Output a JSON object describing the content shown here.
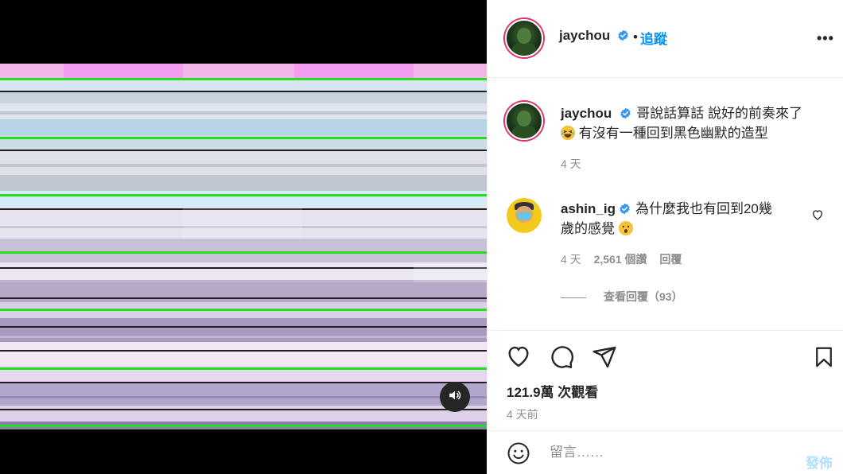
{
  "header": {
    "username": "jaychou",
    "follow_label": "追蹤",
    "separator": "•",
    "more_label": "•••"
  },
  "caption": {
    "username": "jaychou",
    "text_line1": "哥說話算話 說好的前奏來了",
    "text_line2": "有沒有一種回到黑色幽默的造型",
    "time": "4 天"
  },
  "comment": {
    "username": "ashin_ig",
    "text_line1": "為什麼我也有回到20幾",
    "text_line2": "歲的感覺",
    "time": "4 天",
    "likes": "2,561 個讚",
    "reply_label": "回覆",
    "view_replies": "查看回覆（93）"
  },
  "stats": {
    "views": "121.9萬 次觀看",
    "posted": "4 天前"
  },
  "comment_box": {
    "placeholder": "留言……",
    "post_label": "發佈"
  },
  "icons": {
    "verified": "verified-badge-icon",
    "mute": "speaker-icon",
    "like": "heart-icon",
    "comment": "comment-bubble-icon",
    "share": "paper-plane-icon",
    "save": "bookmark-icon",
    "emoji": "smiley-icon"
  },
  "colors": {
    "accent": "#0095f6",
    "verified": "#3897f0",
    "muted": "#8e8e8e",
    "post_disabled": "#b2dffc"
  }
}
